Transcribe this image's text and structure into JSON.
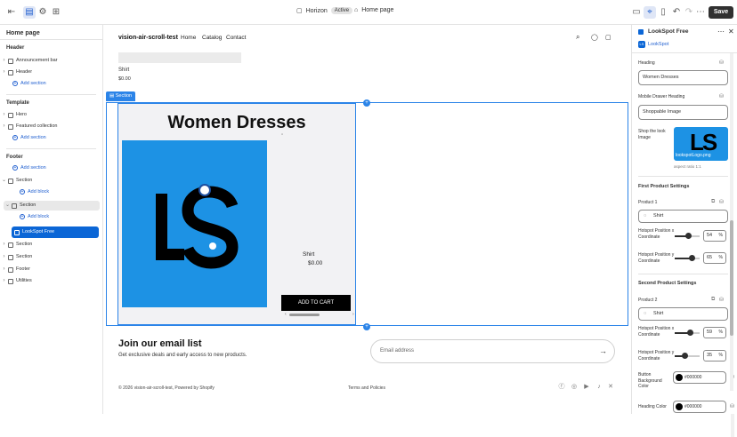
{
  "topbar": {
    "theme_name": "Horizon",
    "theme_status": "Active",
    "page_selector": "Home page",
    "save_label": "Save"
  },
  "left": {
    "title": "Home page",
    "header_heading": "Header",
    "header_items": [
      "Announcement bar",
      "Header"
    ],
    "add_section": "Add section",
    "template_heading": "Template",
    "template_items": [
      "Hero",
      "Featured collection"
    ],
    "footer_heading": "Footer",
    "section_label": "Section",
    "add_block": "Add block",
    "selected_block": "LookSpot Free",
    "footer_items": [
      "Section",
      "Section",
      "Footer",
      "Utilities"
    ]
  },
  "canvas": {
    "store_name": "vision-air-scroll-test",
    "nav": [
      "Home",
      "Catalog",
      "Contact"
    ],
    "prev_product_title": "Shirt",
    "prev_product_price": "$0.00",
    "section_tag": "Section",
    "heading": "Women Dresses",
    "product_title": "Shirt",
    "product_price": "$0.00",
    "add_to_cart": "ADD TO CART",
    "email_heading": "Join our email list",
    "email_sub": "Get exclusive deals and early access to new products.",
    "email_placeholder": "Email address",
    "copyright": "© 2026 vision-air-scroll-test, Powered by Shopify",
    "terms": "Terms and Policies"
  },
  "right": {
    "app_title": "LookSpot Free",
    "app_sub": "LookSpot",
    "heading_label": "Heading",
    "heading_value": "Women Dresses",
    "mobile_label": "Mobile Drawer Heading",
    "mobile_value": "Shoppable Image",
    "shop_label": "Shop the look Image",
    "image_file": "lookspotLogo.png",
    "aspect": "aspect ratio 1:1",
    "first_heading": "First Product Settings",
    "product1_label": "Product 1",
    "product1_value": "Shirt",
    "hx_label": "Hotspot Position x Coordinate",
    "hy_label": "Hotspot Position y Coordinate",
    "p1_x": "54",
    "p1_y": "65",
    "pct": "%",
    "second_heading": "Second Product Settings",
    "product2_label": "Product 2",
    "product2_value": "Shirt",
    "p2_x": "59",
    "p2_y": "35",
    "button_bg_label": "Button Background Color",
    "button_bg_value": "#000000",
    "heading_color_label": "Heading Color",
    "heading_color_value": "#000000"
  },
  "colors": {
    "accent": "#2b84e8",
    "selected": "#0b66d6",
    "image_bg": "#1d92e4"
  }
}
